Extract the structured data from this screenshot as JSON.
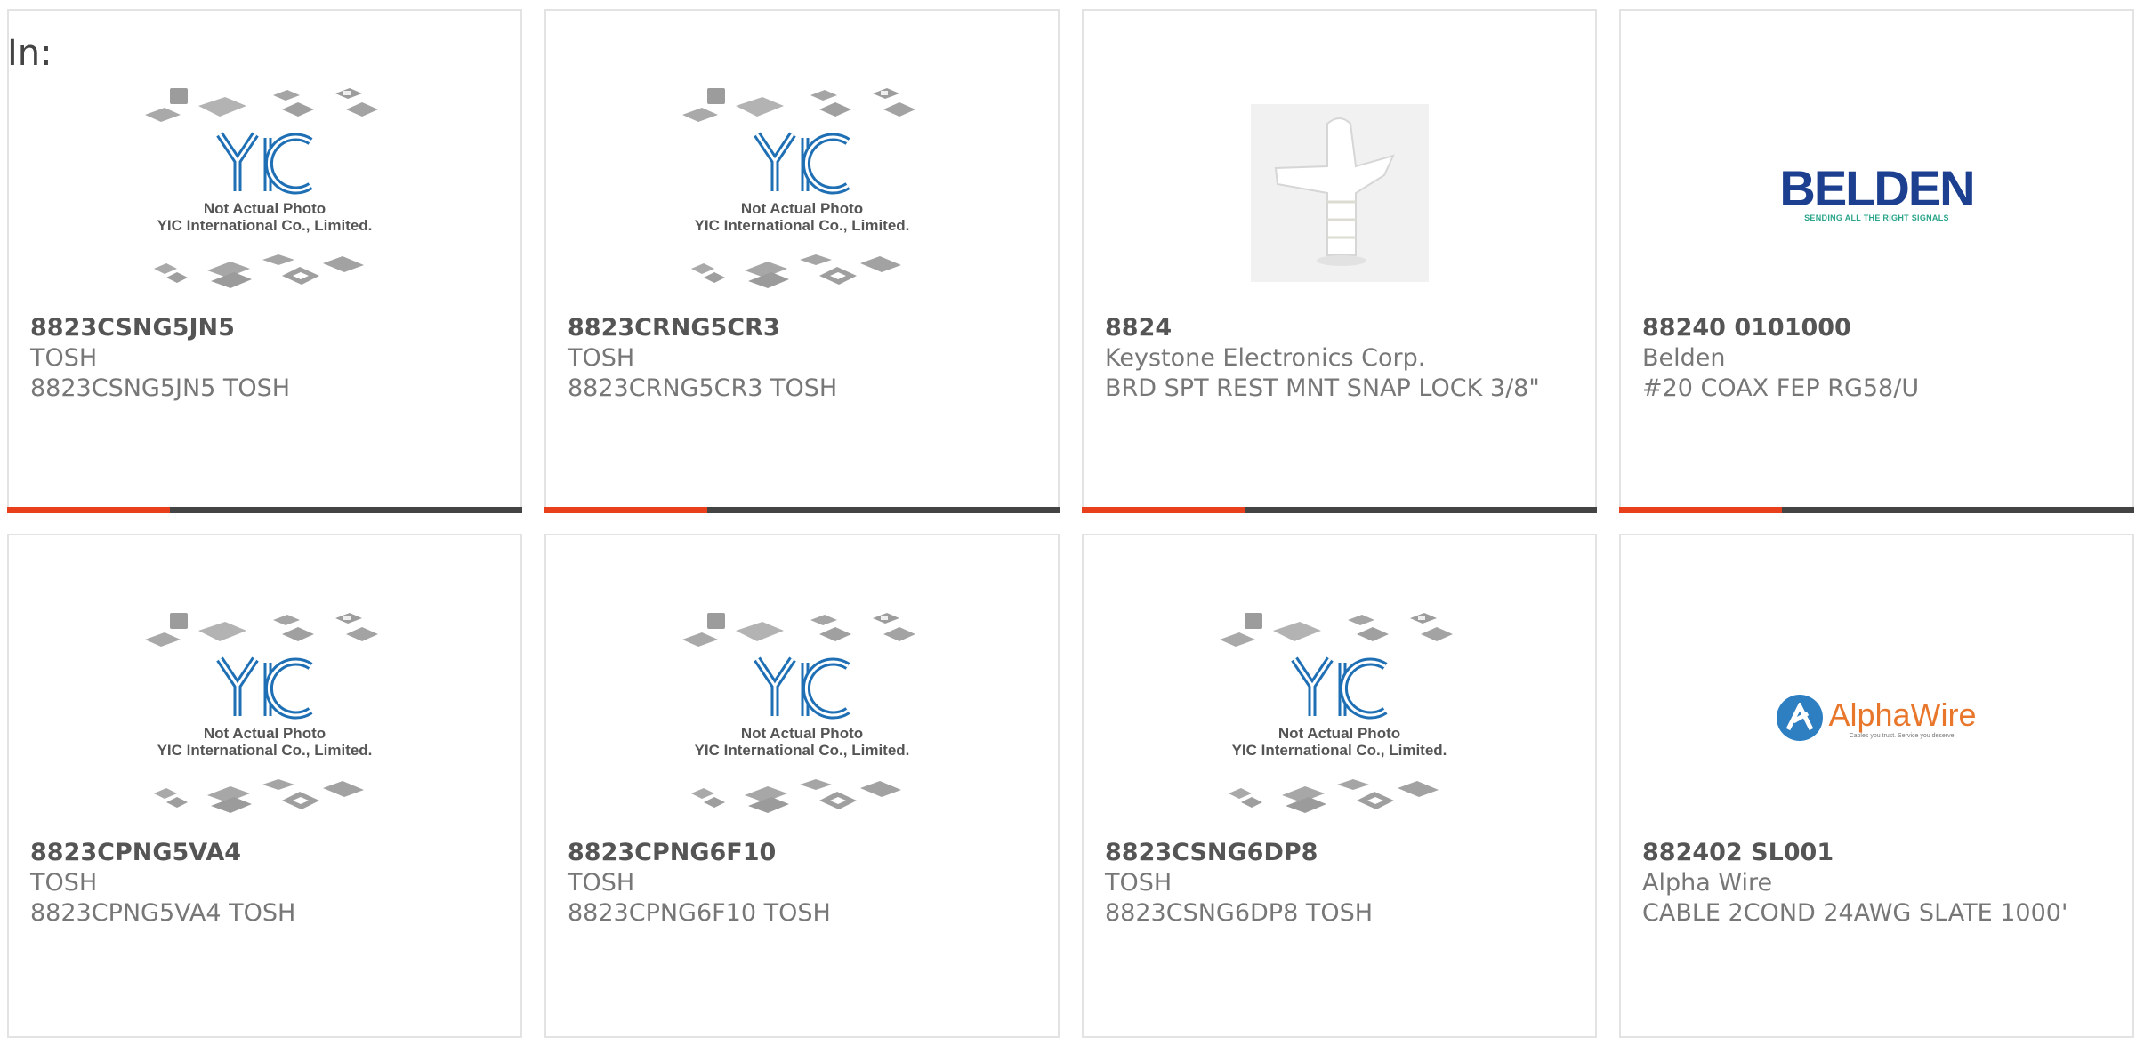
{
  "header": {
    "label": "In:"
  },
  "colors": {
    "accent": "#e8401c",
    "bar": "#444444",
    "belden": "#1d3f8f",
    "alpha_orange": "#e8772c",
    "alpha_blue": "#2d7fc1"
  },
  "placeholder": {
    "line1": "Not Actual Photo",
    "line2": "YIC International Co., Limited."
  },
  "logos": {
    "belden_word": "BELDEN",
    "belden_tag": "SENDING ALL THE RIGHT SIGNALS",
    "alpha_word": "AlphaWire",
    "alpha_slogan": "Cables you trust. Service you deserve."
  },
  "products": [
    {
      "part": "8823CSNG5JN5",
      "manufacturer": "TOSH",
      "description": "8823CSNG5JN5 TOSH",
      "image": "yic-placeholder"
    },
    {
      "part": "8823CRNG5CR3",
      "manufacturer": "TOSH",
      "description": "8823CRNG5CR3 TOSH",
      "image": "yic-placeholder"
    },
    {
      "part": "8824",
      "manufacturer": "Keystone Electronics Corp.",
      "description": "BRD SPT REST MNT SNAP LOCK 3/8\"",
      "image": "clip-photo"
    },
    {
      "part": "88240 0101000",
      "manufacturer": "Belden",
      "description": "#20 COAX FEP RG58/U",
      "image": "belden-logo"
    },
    {
      "part": "8823CPNG5VA4",
      "manufacturer": "TOSH",
      "description": "8823CPNG5VA4 TOSH",
      "image": "yic-placeholder"
    },
    {
      "part": "8823CPNG6F10",
      "manufacturer": "TOSH",
      "description": "8823CPNG6F10 TOSH",
      "image": "yic-placeholder"
    },
    {
      "part": "8823CSNG6DP8",
      "manufacturer": "TOSH",
      "description": "8823CSNG6DP8 TOSH",
      "image": "yic-placeholder"
    },
    {
      "part": "882402 SL001",
      "manufacturer": "Alpha Wire",
      "description": "CABLE 2COND 24AWG SLATE 1000'",
      "image": "alphawire-logo"
    }
  ]
}
